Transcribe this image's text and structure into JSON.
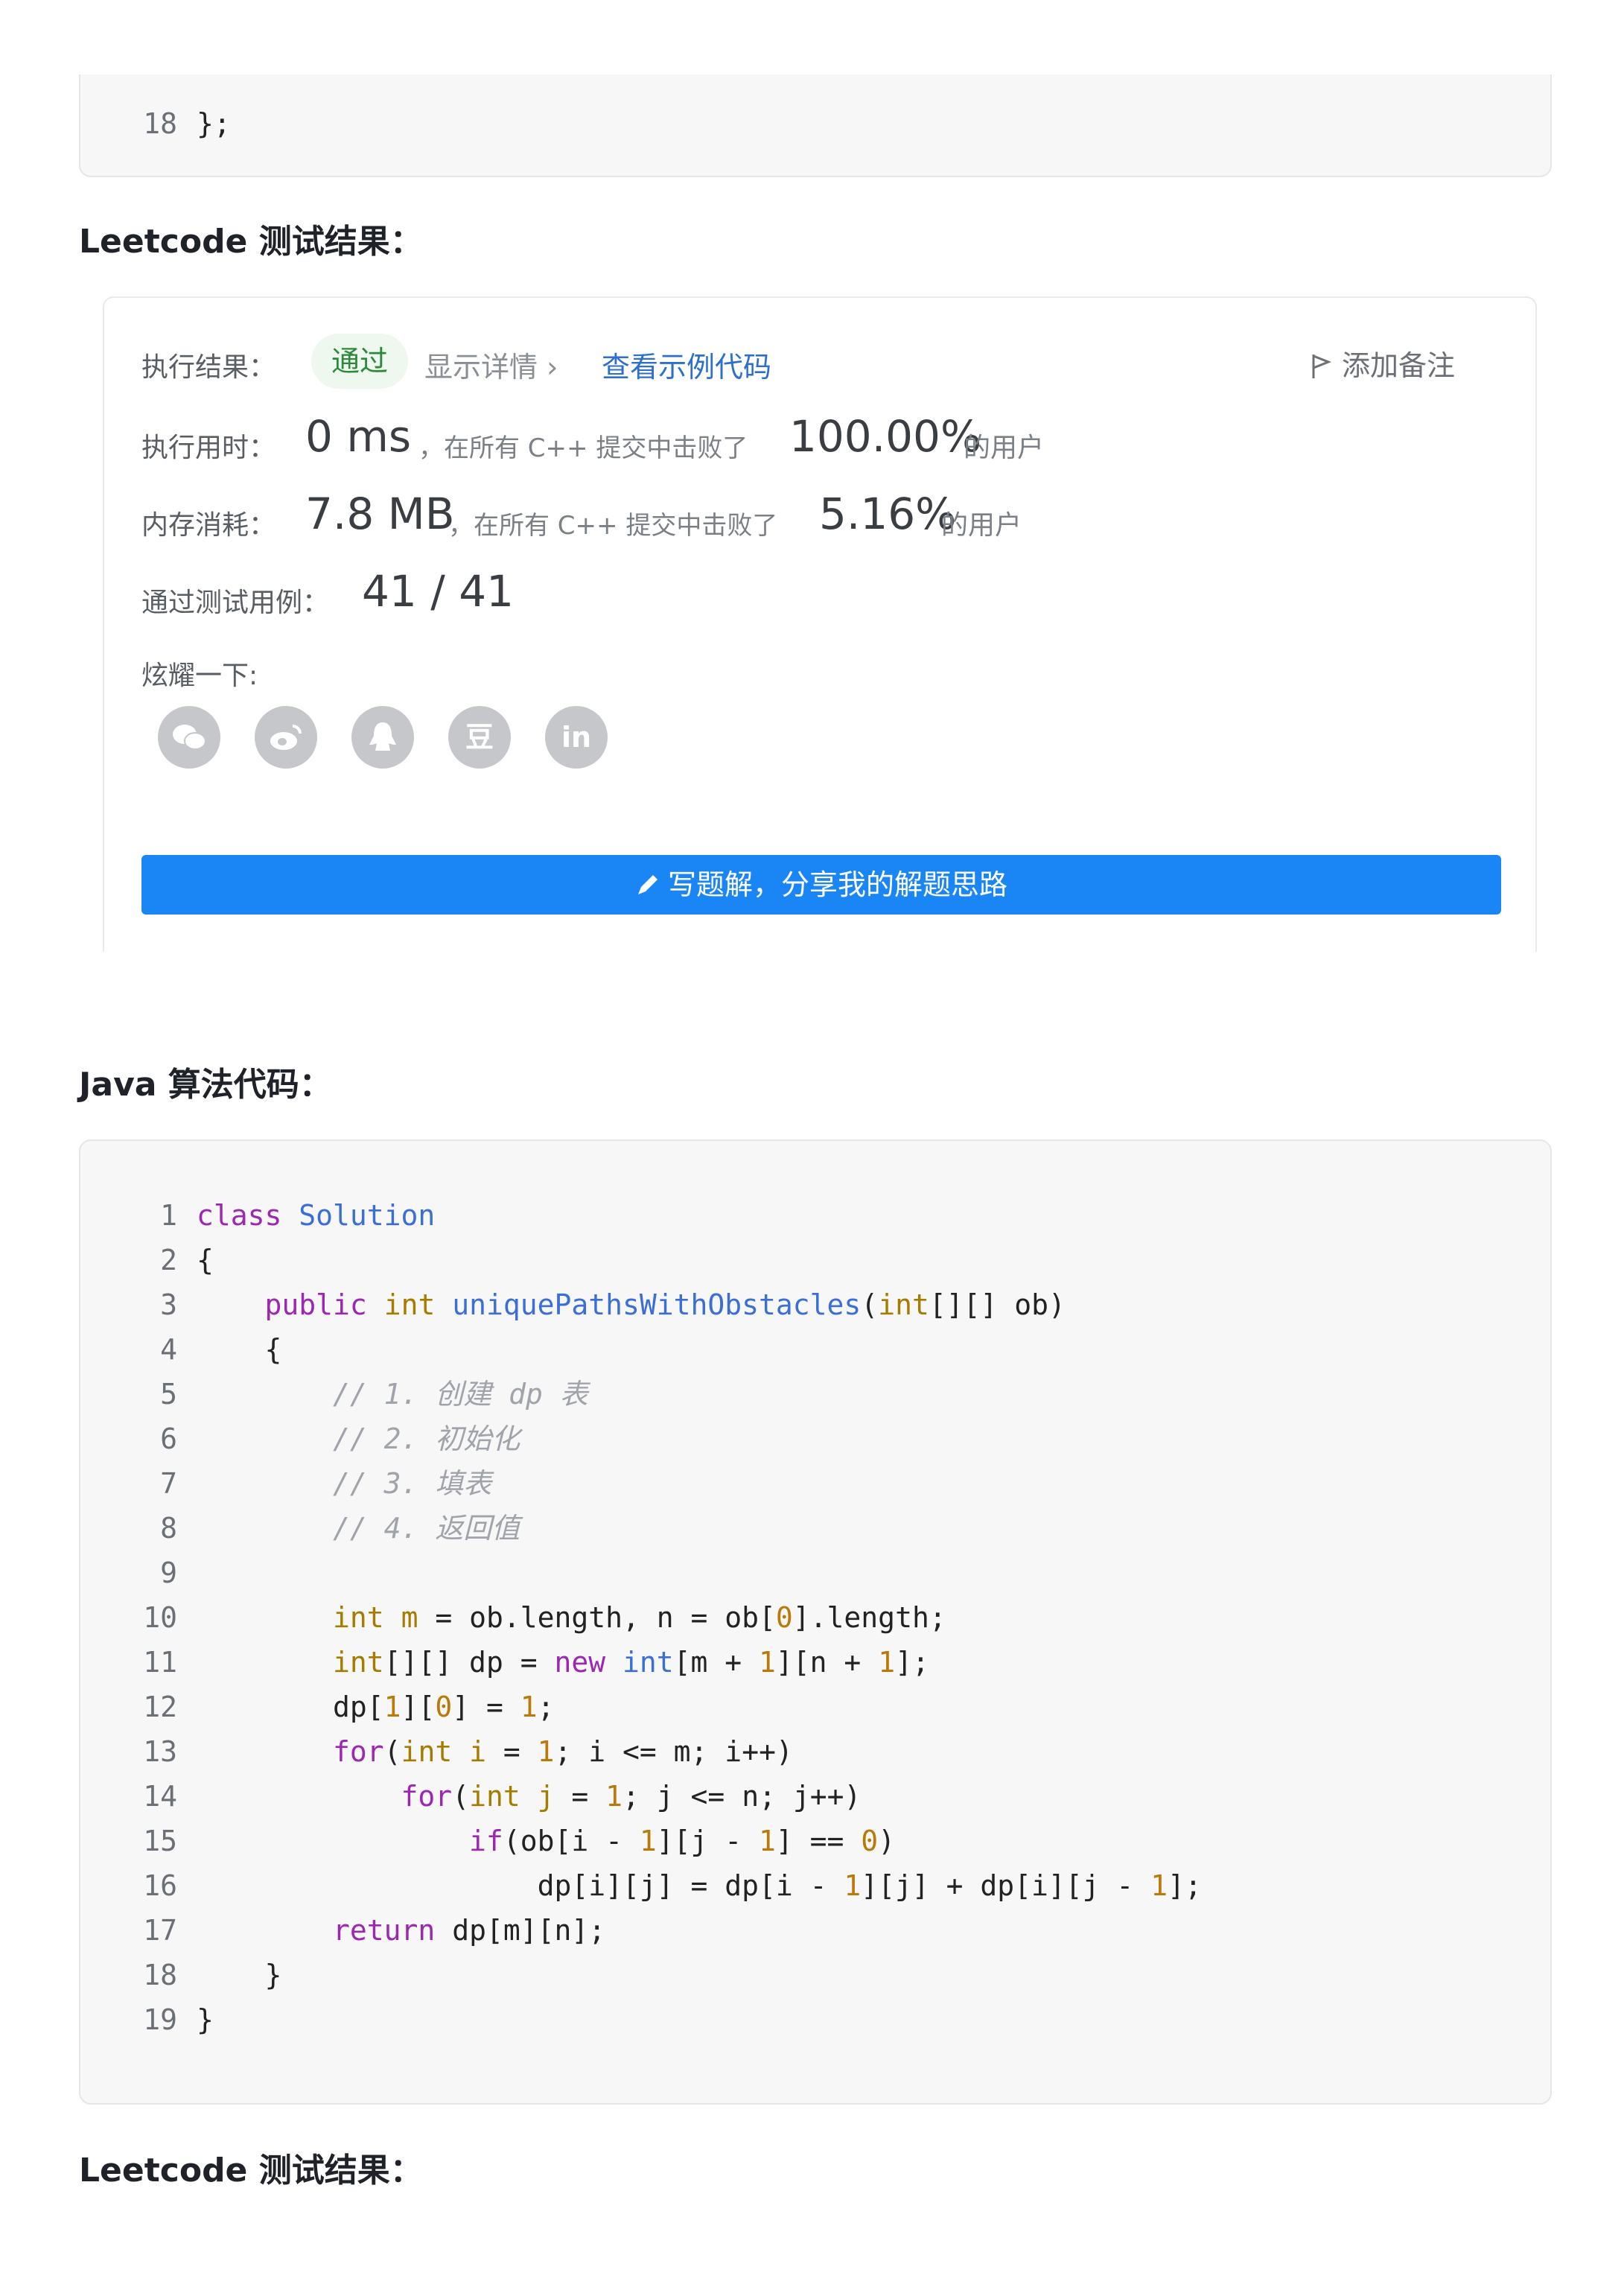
{
  "top_code": {
    "line_number": "18",
    "text": "};"
  },
  "headings": {
    "leetcode_result_1": "Leetcode 测试结果：",
    "java_code": "Java 算法代码：",
    "leetcode_result_2": "Leetcode 测试结果："
  },
  "result_card": {
    "exec_result_label": "执行结果：",
    "pass_badge": "通过",
    "show_details": "显示详情 ›",
    "view_sample": "查看示例代码",
    "add_note": "添加备注",
    "time_label": "执行用时：",
    "time_value": "0 ms",
    "time_desc": "，在所有 C++ 提交中击败了",
    "time_percent": "100.00%",
    "time_suffix": "的用户",
    "mem_label": "内存消耗：",
    "mem_value": "7.8 MB",
    "mem_desc": "，在所有 C++ 提交中击败了",
    "mem_percent": "5.16%",
    "mem_suffix": "的用户",
    "cases_label": "通过测试用例：",
    "cases_value": "41 / 41",
    "share_label": "炫耀一下:",
    "share_icons": [
      "wechat-icon",
      "weibo-icon",
      "qq-icon",
      "douban-icon",
      "linkedin-icon"
    ],
    "douban_glyph": "豆",
    "linkedin_glyph": "in",
    "solution_button": "写题解，分享我的解题思路"
  },
  "java_code": {
    "line_numbers": [
      "1",
      "2",
      "3",
      "4",
      "5",
      "6",
      "7",
      "8",
      "9",
      "10",
      "11",
      "12",
      "13",
      "14",
      "15",
      "16",
      "17",
      "18",
      "19"
    ]
  },
  "colors": {
    "accent_blue": "#1a86f5",
    "pass_green": "#2d8a3a",
    "keyword": "#9c27b0",
    "type": "#a67c00"
  }
}
